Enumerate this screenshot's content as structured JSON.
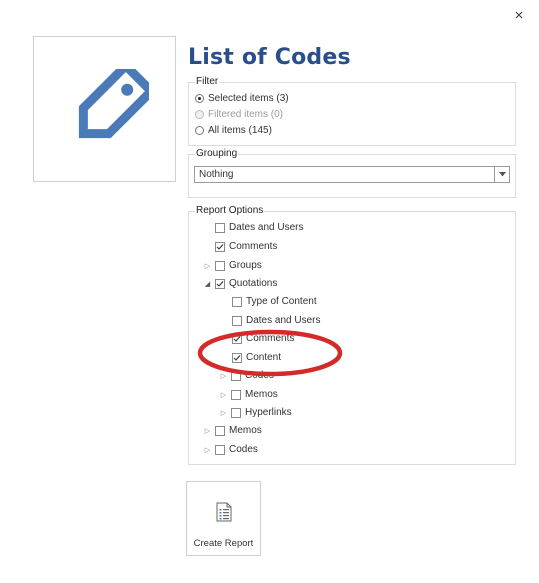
{
  "dialog": {
    "title": "List of Codes",
    "close_icon": "close-icon",
    "tag_icon": "tag-icon"
  },
  "filter": {
    "legend": "Filter",
    "options": [
      {
        "label": "Selected items (3)",
        "state": "checked"
      },
      {
        "label": "Filtered items (0)",
        "state": "disabled"
      },
      {
        "label": "All items (145)",
        "state": "unchecked"
      }
    ]
  },
  "grouping": {
    "legend": "Grouping",
    "value": "Nothing"
  },
  "report_options": {
    "legend": "Report Options",
    "items": [
      {
        "label": "Dates and Users",
        "checked": false,
        "expander": ""
      },
      {
        "label": "Comments",
        "checked": true,
        "expander": ""
      },
      {
        "label": "Groups",
        "checked": false,
        "expander": "collapsed"
      },
      {
        "label": "Quotations",
        "checked": true,
        "expander": "expanded"
      },
      {
        "label": "Type of Content",
        "checked": false,
        "expander": ""
      },
      {
        "label": "Dates and Users",
        "checked": false,
        "expander": ""
      },
      {
        "label": "Comments",
        "checked": true,
        "expander": ""
      },
      {
        "label": "Content",
        "checked": true,
        "expander": ""
      },
      {
        "label": "Codes",
        "checked": false,
        "expander": "collapsed"
      },
      {
        "label": "Memos",
        "checked": false,
        "expander": "collapsed"
      },
      {
        "label": "Hyperlinks",
        "checked": false,
        "expander": "collapsed"
      },
      {
        "label": "Memos",
        "checked": false,
        "expander": "collapsed"
      },
      {
        "label": "Codes",
        "checked": false,
        "expander": "collapsed"
      }
    ]
  },
  "create_report": {
    "label": "Create Report",
    "icon": "report-document-icon"
  },
  "colors": {
    "title": "#2a4e8a",
    "tag_icon": "#4a7ab8",
    "highlight_ellipse": "#d42a2a"
  }
}
